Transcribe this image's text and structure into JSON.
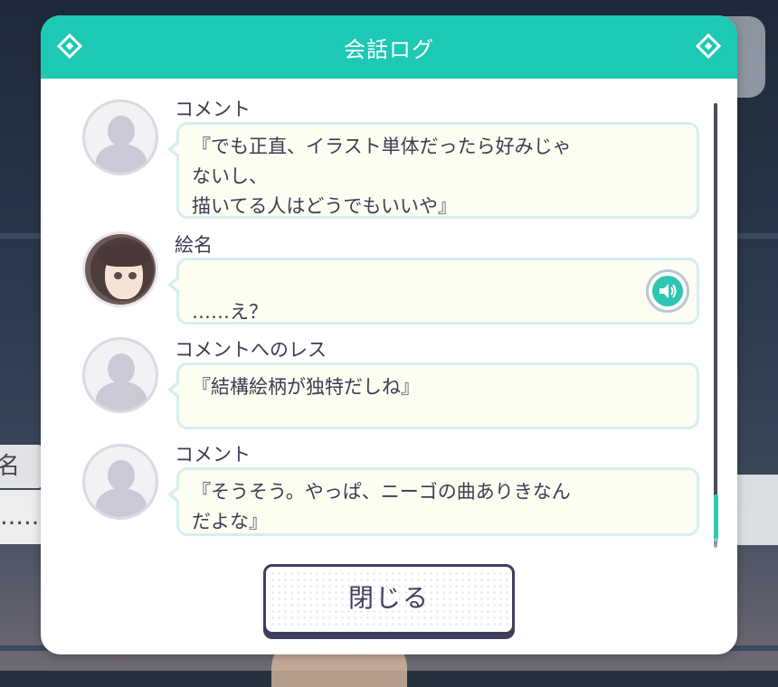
{
  "dialog": {
    "title": "会話ログ",
    "close_label": "閉じる"
  },
  "background": {
    "name_fragment": "名",
    "text_fragment": "……"
  },
  "log": {
    "entries": [
      {
        "speaker": "コメント",
        "text": "『でも正直、イラスト単体だったら好みじゃ\nないし、\n描いてる人はどうでもいいや』",
        "avatar": "placeholder-avatar",
        "has_voice": false
      },
      {
        "speaker": "絵名",
        "text": "……え？",
        "avatar": "ena-avatar",
        "has_voice": true
      },
      {
        "speaker": "コメントへのレス",
        "text": "『結構絵柄が独特だしね』",
        "avatar": "placeholder-avatar",
        "has_voice": false
      },
      {
        "speaker": "コメント",
        "text": "『そうそう。やっぱ、ニーゴの曲ありきなん\nだよな』",
        "avatar": "placeholder-avatar",
        "has_voice": false
      }
    ]
  },
  "colors": {
    "header": "#1dc9b4",
    "accent": "#2fc5b2",
    "text": "#3c3c55",
    "bubble_bg": "#fdfdf1",
    "bubble_border": "#d6eef0"
  },
  "icons": {
    "header_left": "diamond-icon",
    "header_right": "diamond-icon",
    "voice": "speaker-icon"
  }
}
